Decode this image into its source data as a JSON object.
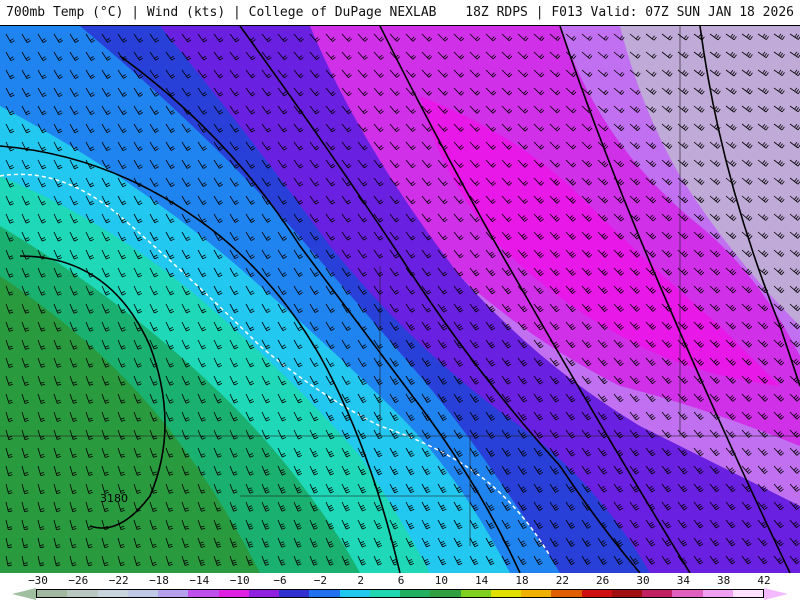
{
  "header": {
    "left": "700mb Temp (°C) | Wind (kts) | College of DuPage NEXLAB",
    "right": "18Z RDPS | F013 Valid: 07Z SUN JAN 18 2026"
  },
  "map": {
    "contour_label": "3180",
    "regions": [
      "green-warm",
      "teal",
      "cyan",
      "blue",
      "indigo",
      "magenta",
      "violet",
      "pale-gray"
    ]
  },
  "scale": {
    "tick_labels": [
      "−30",
      "−26",
      "−22",
      "−18",
      "−14",
      "−10",
      "−6",
      "−2",
      "2",
      "6",
      "10",
      "14",
      "18",
      "22",
      "26",
      "30",
      "34",
      "38",
      "42"
    ],
    "colors": [
      "#a0b8a0",
      "#b8c8c0",
      "#c8d4dc",
      "#c0c8e8",
      "#b4a0ec",
      "#c050ec",
      "#e020e0",
      "#9020e0",
      "#3030d0",
      "#2070f0",
      "#20c8f0",
      "#20d8b0",
      "#20b060",
      "#30a040",
      "#80d020",
      "#e0e000",
      "#f0b000",
      "#e06000",
      "#d01010",
      "#a01010",
      "#c02060",
      "#e060c0",
      "#f0a0f0",
      "#ffe0ff"
    ]
  }
}
